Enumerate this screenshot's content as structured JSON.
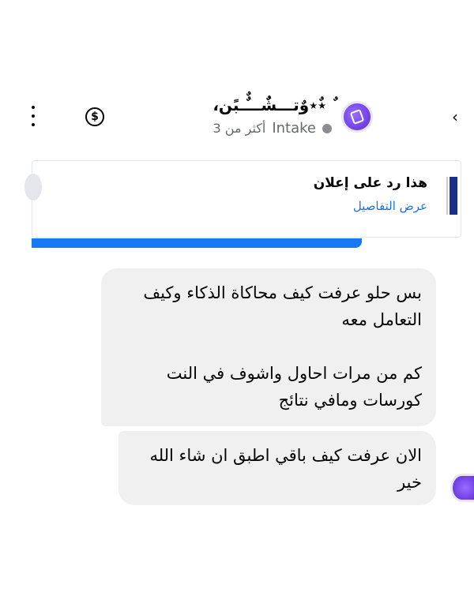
{
  "header": {
    "page_name": "ٌ ٭ٌ٭وٌتـــشٌٌـــٌٌـبًن،",
    "status_label": "Intake",
    "active_time": "أكثر من 3",
    "more_icon": "more-vertical-icon",
    "money_icon": "dollar-circle-icon",
    "back_icon": "chevron-left-icon",
    "avatar_color": "#7b4bf0"
  },
  "ad_card": {
    "title": "هذا رد على إعلان",
    "link": "عرض التفاصيل",
    "progress_color": "#1877f2"
  },
  "messages": [
    {
      "paragraphs": [
        "بس حلو عرفت كيف محاكاة الذكاء وكيف التعامل معه",
        "كم من مرات احاول واشوف في النت كورسات ومافي نتائج"
      ]
    },
    {
      "paragraphs": [
        "الان عرفت كيف باقي اطبق ان شاء الله خير"
      ]
    }
  ],
  "colors": {
    "bubble_bg": "#f0f0f0",
    "link": "#1b74e4",
    "secondary_text": "#65676b"
  }
}
